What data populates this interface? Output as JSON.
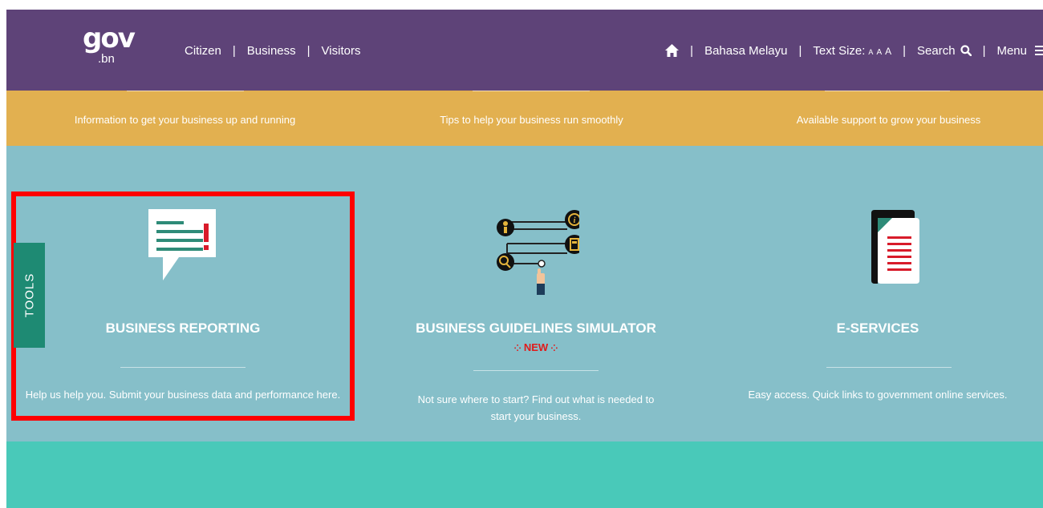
{
  "header": {
    "logo": {
      "main": "gov",
      "sub": ".bn"
    },
    "nav_left": [
      "Citizen",
      "Business",
      "Visitors"
    ],
    "language": "Bahasa Melayu",
    "text_size_label": "Text Size:",
    "text_size_options": [
      "A",
      "A",
      "A"
    ],
    "search_label": "Search",
    "menu_label": "Menu"
  },
  "yellow_band": {
    "items": [
      "Information to get your business up and running",
      "Tips to help your business run smoothly",
      "Available support to grow your business"
    ]
  },
  "cards": [
    {
      "title": "BUSINESS REPORTING",
      "description": "Help us help you. Submit your business data and performance here.",
      "icon": "report-speech-bubble-icon"
    },
    {
      "title": "BUSINESS GUIDELINES SIMULATOR",
      "badge": "NEW",
      "description": "Not sure where to start? Find out what is needed to start your business.",
      "icon": "guidelines-flow-icon"
    },
    {
      "title": "E-SERVICES",
      "description": "Easy access. Quick links to government online services.",
      "icon": "document-icon"
    }
  ],
  "tools_tab": "TOOLS",
  "colors": {
    "navbar": "#5e4378",
    "yellow_band": "#e2b050",
    "cards_bg": "#86bfc9",
    "highlight": "#ff0000",
    "tools_tab": "#1e8a73",
    "bottom_band": "#49c9b9",
    "new_badge": "#e01b1b"
  }
}
